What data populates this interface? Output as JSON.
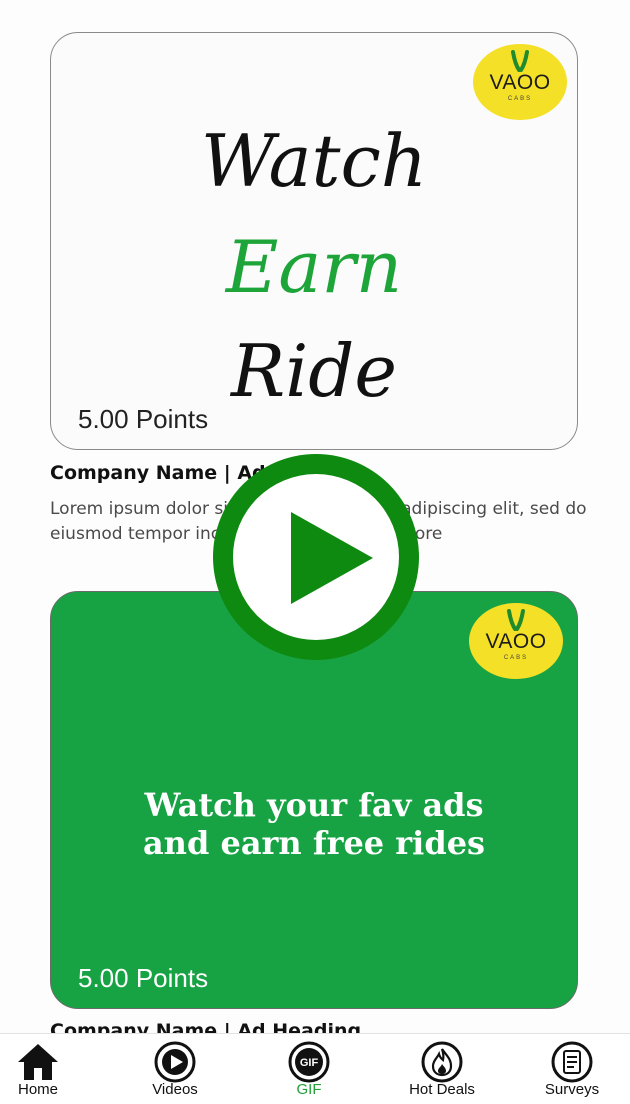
{
  "cards": [
    {
      "logo": {
        "brand": "VAOO",
        "tagline": "CABS"
      },
      "headline_lines": [
        "Watch",
        "Earn",
        "Ride"
      ],
      "points": "5.00 Points",
      "title": "Company Name | Advertising",
      "description": "Lorem ipsum dolor sit amet, consectetur adipiscing elit, sed do eiusmod tempor incididunt ut labore et dolore"
    },
    {
      "logo": {
        "brand": "VAOO",
        "tagline": "CABS"
      },
      "headline_lines": [
        "Watch your fav ads",
        "and earn free rides"
      ],
      "points": "5.00 Points",
      "title": "Company Name | Ad Heading"
    }
  ],
  "play_overlay": {
    "icon": "play-icon",
    "color": "#0e8a10"
  },
  "tabbar": {
    "items": [
      {
        "label": "Home",
        "icon": "home-icon"
      },
      {
        "label": "Videos",
        "icon": "video-play-icon"
      },
      {
        "label": "GIF",
        "icon": "gif-icon",
        "active": true
      },
      {
        "label": "Hot Deals",
        "icon": "flame-icon"
      },
      {
        "label": "Surveys",
        "icon": "survey-icon"
      }
    ],
    "active_color": "#22a03a"
  },
  "colors": {
    "brand_green": "#17a344",
    "logo_yellow": "#f4e026",
    "accent_green": "#1ea53a"
  }
}
